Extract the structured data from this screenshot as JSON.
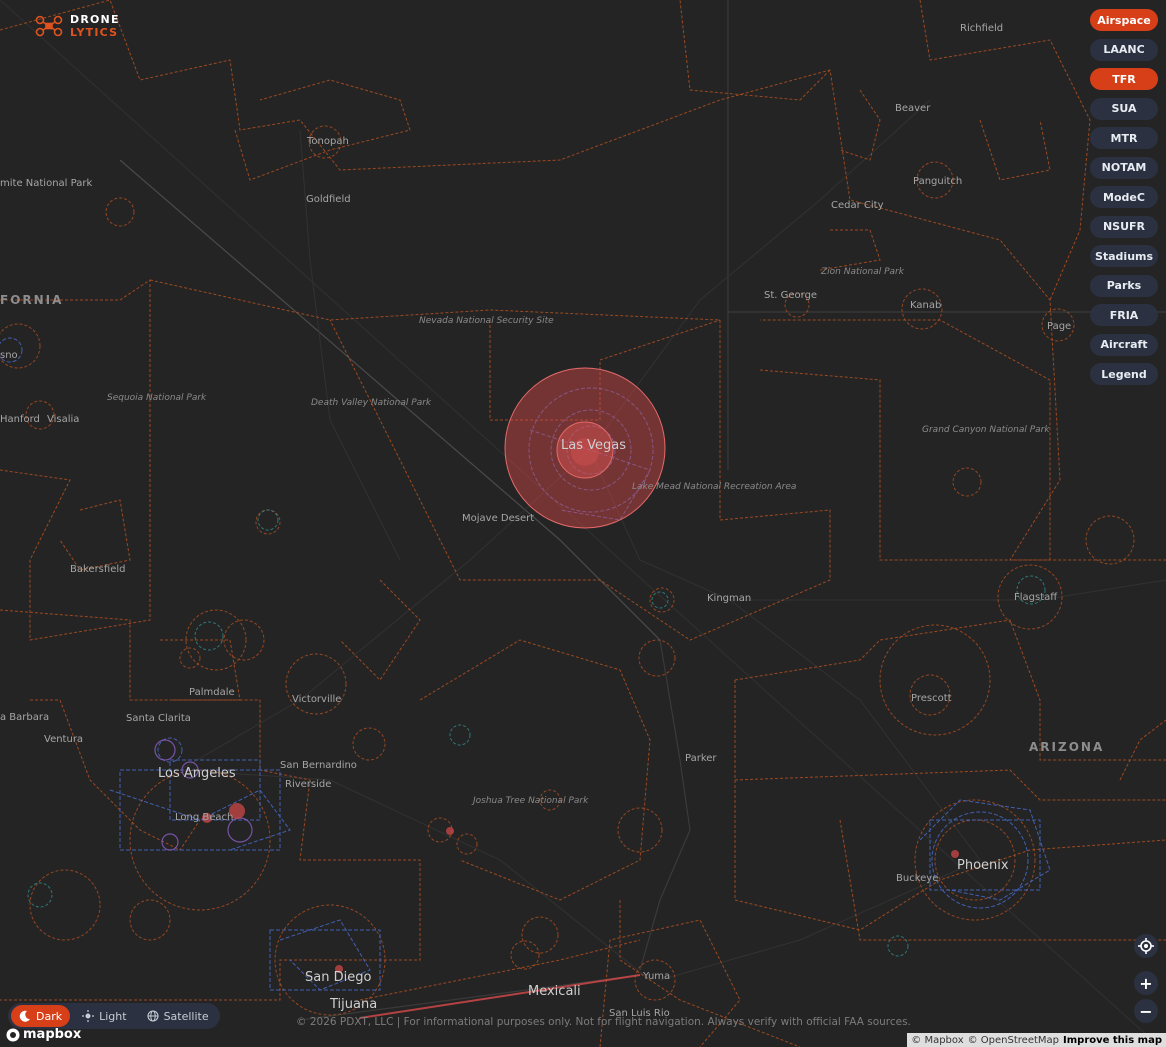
{
  "brand": {
    "line1": "DRONE",
    "line2": "LYTICS",
    "logo_icon": "drone-icon",
    "accent": "#e0531f"
  },
  "layers": [
    {
      "label": "Airspace",
      "active": true
    },
    {
      "label": "LAANC",
      "active": false
    },
    {
      "label": "TFR",
      "active": true
    },
    {
      "label": "SUA",
      "active": false
    },
    {
      "label": "MTR",
      "active": false
    },
    {
      "label": "NOTAM",
      "active": false
    },
    {
      "label": "ModeC",
      "active": false
    },
    {
      "label": "NSUFR",
      "active": false
    },
    {
      "label": "Stadiums",
      "active": false
    },
    {
      "label": "Parks",
      "active": false
    },
    {
      "label": "FRIA",
      "active": false
    },
    {
      "label": "Aircraft",
      "active": false
    },
    {
      "label": "Legend",
      "active": false
    }
  ],
  "controls": {
    "locate_icon": "crosshair-icon",
    "zoom_in": "+",
    "zoom_out": "−"
  },
  "theme": [
    {
      "label": "Dark",
      "icon": "moon-icon",
      "active": true
    },
    {
      "label": "Light",
      "icon": "sun-icon",
      "active": false
    },
    {
      "label": "Satellite",
      "icon": "globe-icon",
      "active": false
    }
  ],
  "mapbox_logo": "mapbox",
  "disclaimer": "© 2026 PDXT, LLC | For informational purposes only. Not for flight navigation. Always verify with official FAA sources.",
  "attribution": {
    "mapbox": "© Mapbox",
    "osm": "© OpenStreetMap",
    "improve": "Improve this map"
  },
  "map_labels": {
    "richfield": "Richfield",
    "beaver": "Beaver",
    "tonopah": "Tonopah",
    "goldfield": "Goldfield",
    "yosemite": "mite National Park",
    "panguitch": "Panguitch",
    "cedar_city": "Cedar City",
    "zion": "Zion National Park",
    "st_george": "St. George",
    "kanab": "Kanab",
    "page": "Page",
    "california": "FORNIA",
    "nevada_site": "Nevada National Security Site",
    "sequoia": "Sequoia National Park",
    "death_valley": "Death Valley National Park",
    "fresno": "sno",
    "hanford": "Hanford",
    "visalia": "Visalia",
    "las_vegas": "Las Vegas",
    "lake_mead": "Lake Mead National Recreation Area",
    "grand_canyon": "Grand Canyon National Park",
    "mojave": "Mojave Desert",
    "bakersfield": "Bakersfield",
    "kingman": "Kingman",
    "flagstaff": "Flagstaff",
    "palmdale": "Palmdale",
    "victorville": "Victorville",
    "prescott": "Prescott",
    "santa_barbara": "a Barbara",
    "santa_clarita": "Santa Clarita",
    "ventura": "Ventura",
    "arizona": "ARIZONA",
    "los_angeles": "Los Angeles",
    "san_bernardino": "San Bernardino",
    "riverside": "Riverside",
    "parker": "Parker",
    "long_beach": "Long Beach",
    "joshua_tree": "Joshua Tree National Park",
    "phoenix": "Phoenix",
    "buckeye": "Buckeye",
    "san_diego": "San Diego",
    "tijuana": "Tijuana",
    "mexicali": "Mexicali",
    "yuma": "Yuma",
    "san_luis": "San Luis Rio"
  },
  "colors": {
    "airspace_line": "#c4561f",
    "tfr_fill": "#d94a4a",
    "class_b": "#4a6fd6",
    "background": "#242424"
  }
}
